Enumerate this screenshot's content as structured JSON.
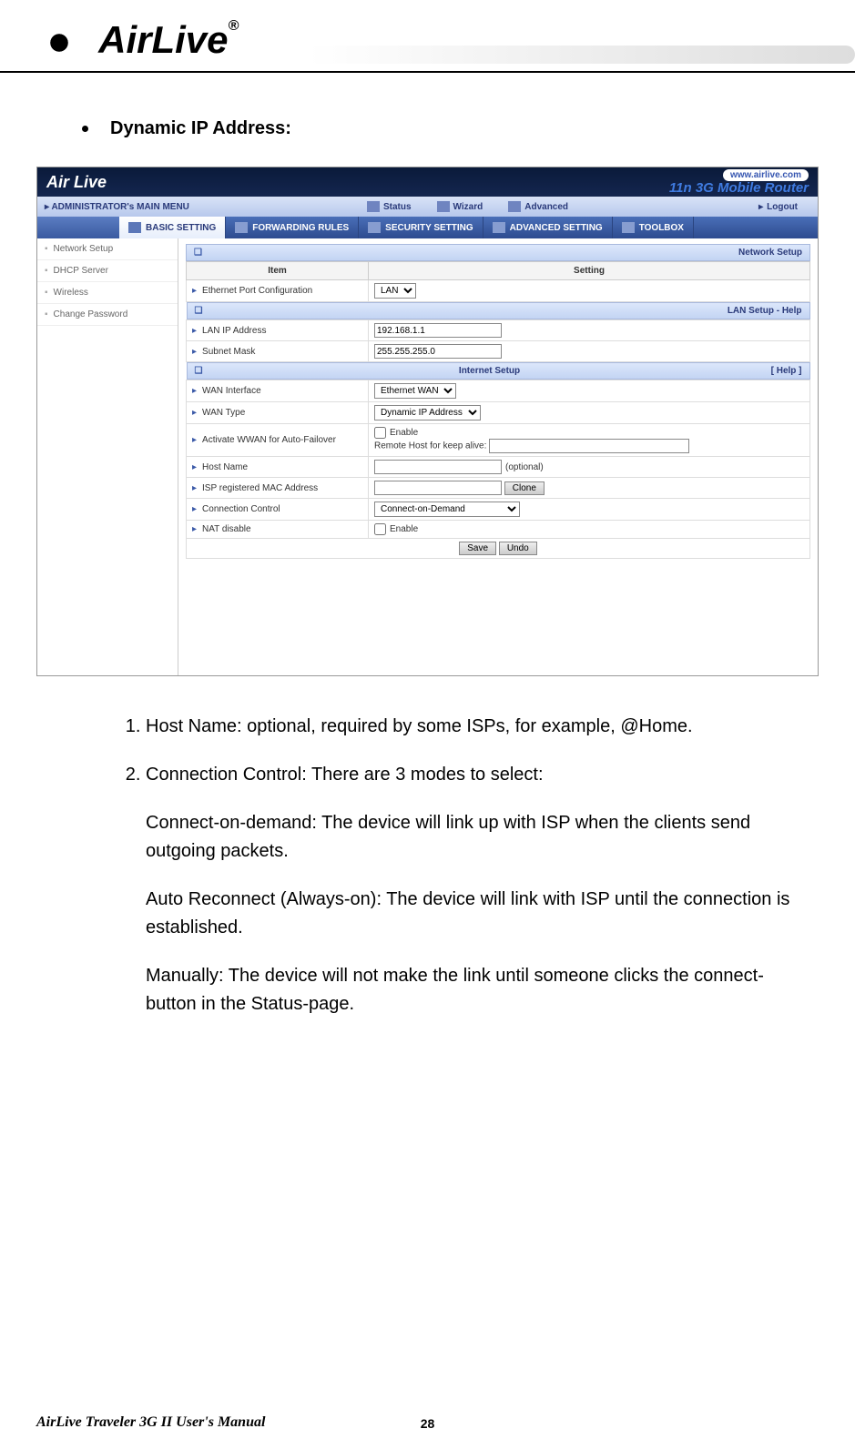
{
  "doc": {
    "logo_text": "AirLive",
    "logo_reg": "®",
    "heading": "Dynamic IP Address:",
    "manual_name": "AirLive Traveler 3G II User's Manual",
    "page_number": "28"
  },
  "shot": {
    "logo": "Air Live",
    "url_pill": "www.airlive.com",
    "tagline": "11n 3G Mobile Router",
    "mainmenu_title": "ADMINISTRATOR's MAIN MENU",
    "mainmenu": {
      "status": "Status",
      "wizard": "Wizard",
      "advanced": "Advanced",
      "logout": "Logout"
    },
    "submenu": {
      "basic": "BASIC SETTING",
      "forwarding": "FORWARDING RULES",
      "security": "SECURITY SETTING",
      "advanced": "ADVANCED SETTING",
      "toolbox": "TOOLBOX"
    },
    "sidebar": {
      "network": "Network Setup",
      "dhcp": "DHCP Server",
      "wireless": "Wireless",
      "changepw": "Change Password"
    },
    "panels": {
      "network_setup": "Network Setup",
      "lan_help": "LAN Setup - Help",
      "internet_setup": "Internet Setup",
      "help_link": "[ Help ]"
    },
    "table": {
      "col_item": "Item",
      "col_setting": "Setting",
      "eth_port": "Ethernet Port Configuration",
      "eth_port_val": "LAN",
      "lan_ip": "LAN IP Address",
      "lan_ip_val": "192.168.1.1",
      "subnet": "Subnet Mask",
      "subnet_val": "255.255.255.0",
      "wan_if": "WAN Interface",
      "wan_if_val": "Ethernet WAN",
      "wan_type": "WAN Type",
      "wan_type_val": "Dynamic IP Address",
      "wwan_failover": "Activate WWAN for Auto-Failover",
      "enable_label": "Enable",
      "remote_host_label": "Remote Host for keep alive:",
      "remote_host_val": "",
      "host_name": "Host Name",
      "host_name_val": "",
      "optional": "(optional)",
      "isp_mac": "ISP registered MAC Address",
      "isp_mac_val": "",
      "clone_btn": "Clone",
      "conn_ctrl": "Connection Control",
      "conn_ctrl_val": "Connect-on-Demand",
      "nat_disable": "NAT disable",
      "save_btn": "Save",
      "undo_btn": "Undo"
    }
  },
  "text": {
    "li1": "Host Name: optional, required by some ISPs, for example, @Home.",
    "li2": "Connection Control: There are 3 modes to select:",
    "p1": "Connect-on-demand: The device will link up with ISP when the clients send outgoing packets.",
    "p2": "Auto Reconnect (Always-on): The device will link with ISP until the connection is established.",
    "p3": "Manually: The device will not make the link until someone clicks the connect-button in the Status-page."
  }
}
